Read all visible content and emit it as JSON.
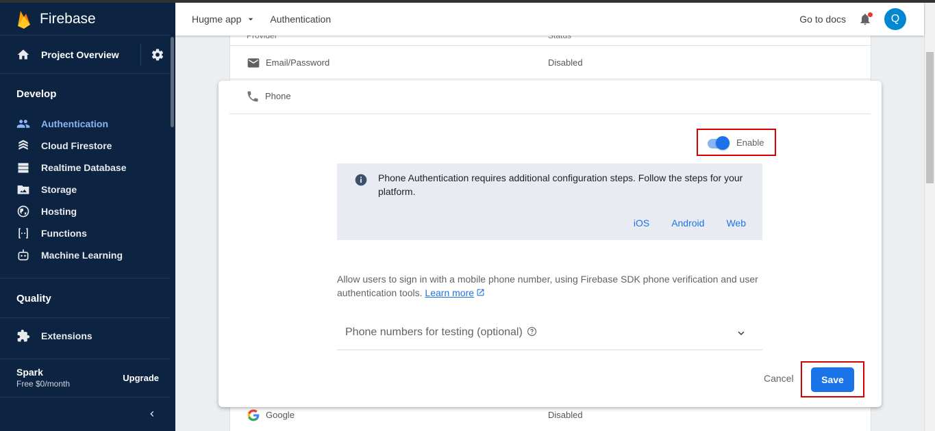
{
  "sidebar": {
    "brand": "Firebase",
    "project_overview": "Project Overview",
    "develop_title": "Develop",
    "develop_items": [
      {
        "label": "Authentication",
        "icon": "people-icon",
        "active": true
      },
      {
        "label": "Cloud Firestore",
        "icon": "firestore-icon"
      },
      {
        "label": "Realtime Database",
        "icon": "database-icon"
      },
      {
        "label": "Storage",
        "icon": "storage-icon"
      },
      {
        "label": "Hosting",
        "icon": "globe-icon"
      },
      {
        "label": "Functions",
        "icon": "functions-icon"
      },
      {
        "label": "Machine Learning",
        "icon": "robot-icon"
      }
    ],
    "quality_title": "Quality",
    "extensions": "Extensions",
    "plan_name": "Spark",
    "plan_price": "Free $0/month",
    "upgrade": "Upgrade"
  },
  "header": {
    "project": "Hugme app",
    "breadcrumb": "Authentication",
    "docs": "Go to docs",
    "avatar_letter": "Q"
  },
  "providers": {
    "col_provider": "Provider",
    "col_status": "Status",
    "rows": [
      {
        "name": "Email/Password",
        "status": "Disabled",
        "icon": "mail-icon"
      },
      {
        "name": "Google",
        "status": "Disabled",
        "icon": "google-icon"
      }
    ]
  },
  "phone_card": {
    "provider_name": "Phone",
    "enable_label": "Enable",
    "enabled": true,
    "info_message": "Phone Authentication requires additional configuration steps. Follow the steps for your platform.",
    "platform_links": [
      "iOS",
      "Android",
      "Web"
    ],
    "description": "Allow users to sign in with a mobile phone number, using Firebase SDK phone verification and user authentication tools.",
    "learn_more": "Learn more",
    "testing_label": "Phone numbers for testing (optional)",
    "cancel": "Cancel",
    "save": "Save"
  },
  "colors": {
    "accent": "#1a73e8",
    "sidebar_bg": "#0c2441",
    "highlight_box": "#d50000"
  }
}
